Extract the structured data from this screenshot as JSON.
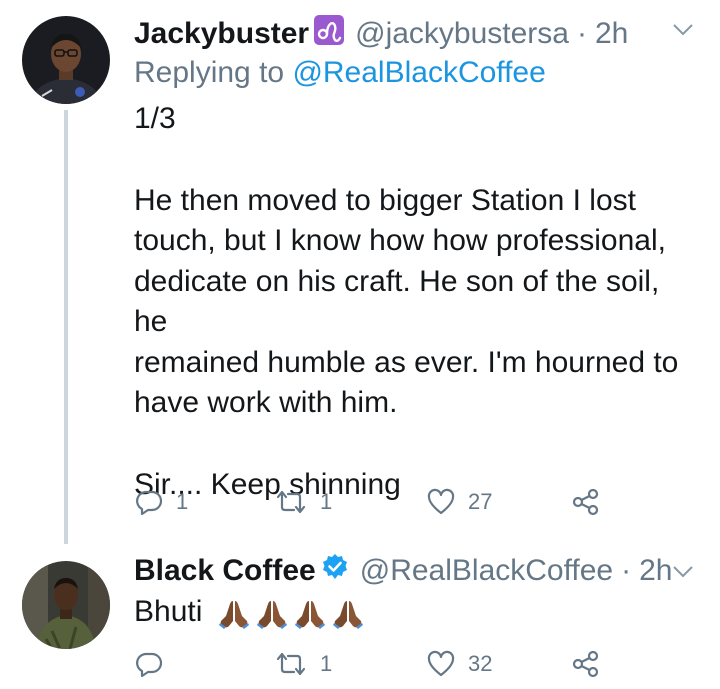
{
  "tweets": [
    {
      "author": "Jackybuster",
      "badge": "leo-zodiac-badge",
      "handle": "@jackybustersa",
      "separator": "·",
      "time": "2h",
      "reply_prefix": "Replying to",
      "reply_handle": "@RealBlackCoffee",
      "lines": [
        "1/3",
        "He then moved to bigger Station I lost",
        "touch, but I know how how professional,",
        "dedicate on his craft. He son of the soil, he",
        "remained humble as ever. I'm hourned to",
        "have work with him.",
        "Sir.... Keep shinning"
      ],
      "reply_count": "1",
      "retweet_count": "1",
      "like_count": "27"
    },
    {
      "author": "Black Coffee",
      "badge": "verified-badge",
      "handle": "@RealBlackCoffee",
      "separator": "·",
      "time": "2h",
      "text": "Bhuti",
      "emojis": [
        "folded-hands-emoji",
        "folded-hands-emoji",
        "folded-hands-emoji",
        "folded-hands-emoji"
      ],
      "reply_count": "",
      "retweet_count": "1",
      "like_count": "32"
    }
  ],
  "colors": {
    "text": "#14171a",
    "secondary": "#657786",
    "link": "#1b95e0",
    "thread_line": "#ccd6dd",
    "zodiac_badge": "#9b59d0",
    "verified": "#1da1f2"
  }
}
